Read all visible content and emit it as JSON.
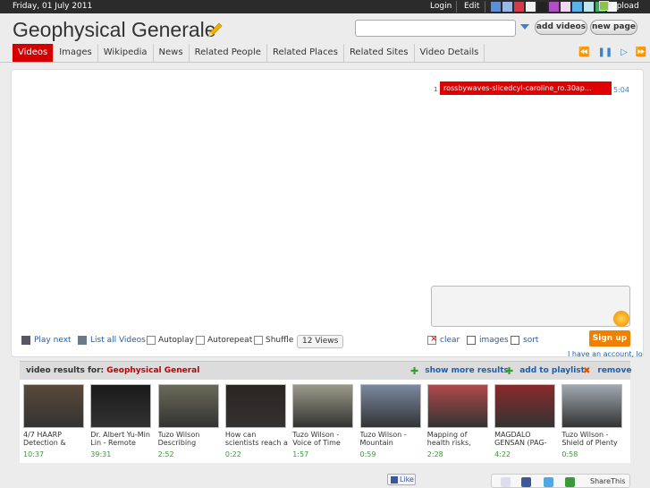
{
  "topbar": {
    "date": "Friday, 01 July 2011",
    "login": "Login",
    "edit": "Edit",
    "swatches": [
      "#5b8fd6",
      "#9ab7e8",
      "#d43a4a",
      "#f0f0f0",
      "#222222",
      "#b04ec4",
      "#f0d8f0",
      "#5ab0e8",
      "#bfe6f0",
      "#3aa860",
      "#f4f4f4"
    ],
    "upload": "upload"
  },
  "header": {
    "title": "Geophysical Generale",
    "search_value": "",
    "add_videos": "add videos",
    "new_page": "new page"
  },
  "tabs": [
    "Videos",
    "Images",
    "Wikipedia",
    "News",
    "Related People",
    "Related Places",
    "Related Sites",
    "Video Details"
  ],
  "active_tab": "Videos",
  "playlist": {
    "num": "1",
    "item": "rossbywaves-slicedcyl-caroline_ro.30ap...",
    "duration": "5:04"
  },
  "controls": {
    "play_next": "Play next",
    "list_all": "List all Videos",
    "autoplay": "Autoplay",
    "autorepeat": "Autorepeat",
    "shuffle": "Shuffle",
    "views": "12 Views",
    "clear": "clear",
    "images": "images",
    "sort": "sort",
    "signup": "Sign up",
    "account": "I have an account, lo"
  },
  "results": {
    "label": "video results for:",
    "query": "Geophysical General",
    "show_more": "show more results",
    "add_playlist": "add to playlist",
    "remove": "remove"
  },
  "videos": [
    {
      "title": "4/7 HAARP Detection &",
      "duration": "10:37",
      "color": "#5a4a3a"
    },
    {
      "title": "Dr. Albert Yu-Min Lin - Remote",
      "duration": "39:31",
      "color": "#1a1a1a"
    },
    {
      "title": "Tuzo Wilson Describing",
      "duration": "2:52",
      "color": "#6a6a5a"
    },
    {
      "title": "How can scientists reach a",
      "duration": "0:22",
      "color": "#2a2622"
    },
    {
      "title": "Tuzo Wilson - Voice of Time",
      "duration": "1:57",
      "color": "#9a9a8a"
    },
    {
      "title": "Tuzo Wilson - Mountain",
      "duration": "0:59",
      "color": "#7a8aa0"
    },
    {
      "title": "Mapping of health risks,",
      "duration": "2:28",
      "color": "#b04a4a"
    },
    {
      "title": "MAGDALO GENSAN (PAG-",
      "duration": "4:22",
      "color": "#8a2a2a"
    },
    {
      "title": "Tuzo Wilson - Shield of Plenty",
      "duration": "0:58",
      "color": "#a0a8b0"
    }
  ],
  "footer": {
    "like": "Like",
    "share": "ShareThis"
  }
}
